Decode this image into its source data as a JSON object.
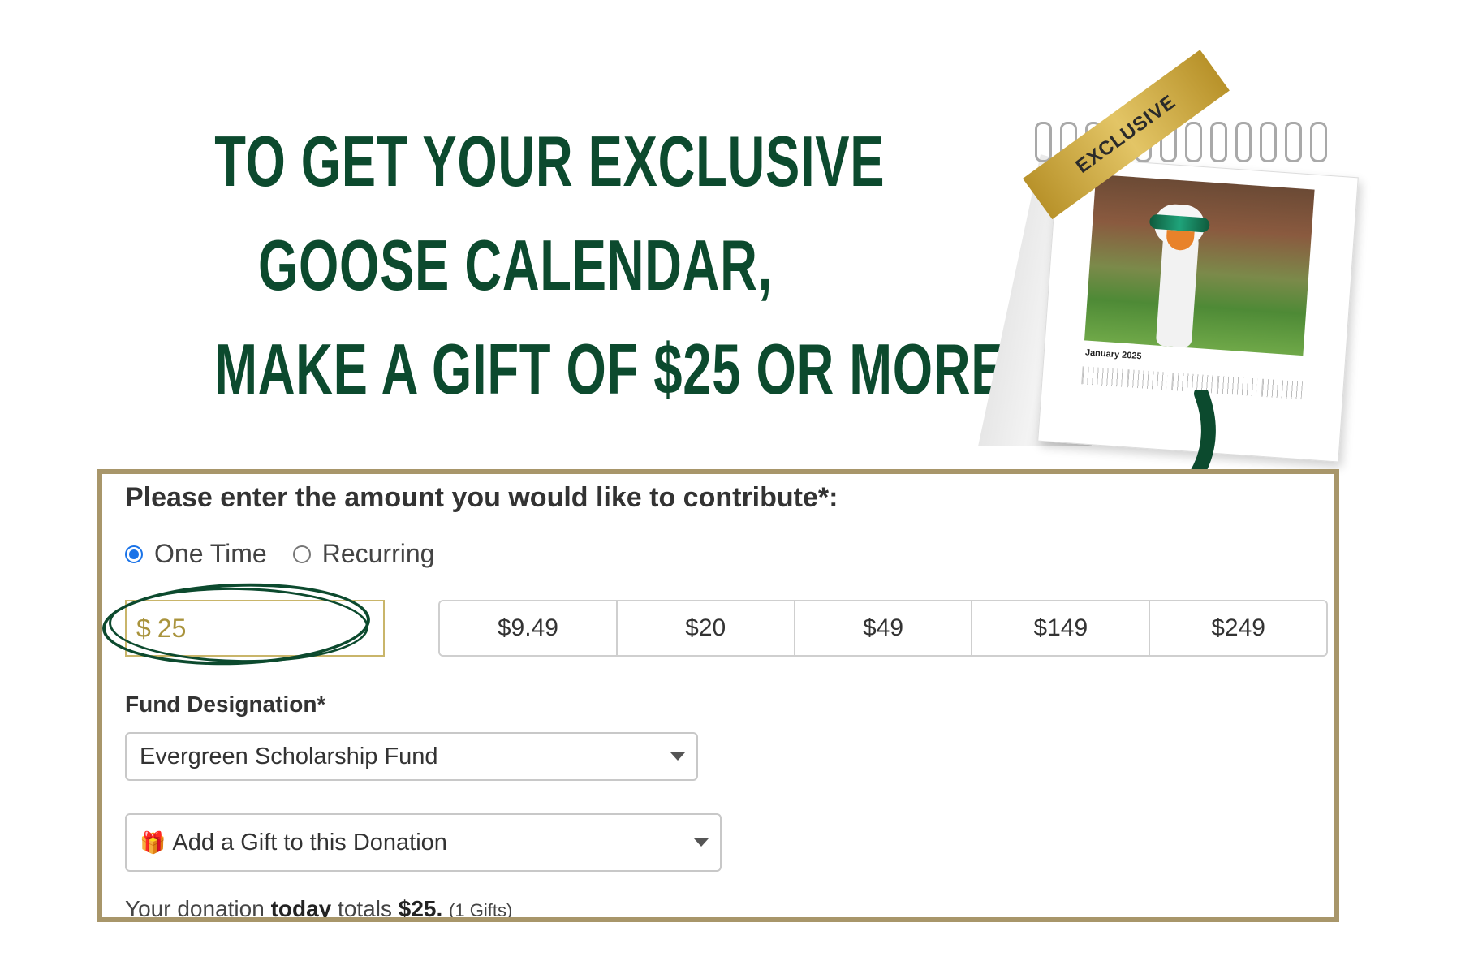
{
  "headline": {
    "line1": "To get your exclusive",
    "line2": "goose calendar,",
    "line3": "make a gift of $25 or more!"
  },
  "calendar": {
    "ribbon_text": "EXCLUSIVE",
    "month_label": "January 2025"
  },
  "form": {
    "prompt": "Please enter the amount you would like to contribute*:",
    "frequency": {
      "options": [
        "One Time",
        "Recurring"
      ],
      "selected": "One Time"
    },
    "amount": {
      "currency": "$",
      "value": "25"
    },
    "presets": [
      "$9.49",
      "$20",
      "$49",
      "$149",
      "$249"
    ],
    "fund_label": "Fund Designation*",
    "fund_selected": "Evergreen Scholarship Fund",
    "gift_selected": "Add a Gift to this Donation",
    "total": {
      "prefix": "Your donation",
      "today": "today",
      "middle": "totals",
      "amount": "$25.",
      "gifts": "(1 Gifts)"
    }
  },
  "colors": {
    "brand_green": "#0c4a2e",
    "gold_border": "#a8966a",
    "radio_blue": "#1a73e8"
  },
  "icons": [
    "gift-icon",
    "chevron-down-icon",
    "curved-arrow-icon"
  ]
}
